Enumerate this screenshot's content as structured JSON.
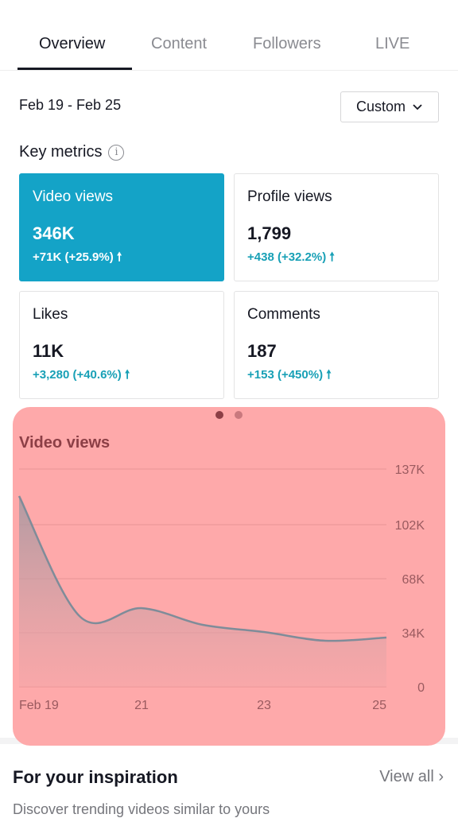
{
  "tabs": [
    {
      "label": "Overview",
      "active": true
    },
    {
      "label": "Content"
    },
    {
      "label": "Followers"
    },
    {
      "label": "LIVE"
    }
  ],
  "date_range": "Feb 19 - Feb 25",
  "range_select": "Custom",
  "key_metrics": {
    "title": "Key metrics",
    "cards": [
      {
        "label": "Video views",
        "value": "346K",
        "change": "+71K (+25.9%)",
        "selected": true
      },
      {
        "label": "Profile views",
        "value": "1,799",
        "change": "+438 (+32.2%)"
      },
      {
        "label": "Likes",
        "value": "11K",
        "change": "+3,280 (+40.6%)"
      },
      {
        "label": "Comments",
        "value": "187",
        "change": "+153 (+450%)"
      }
    ]
  },
  "colors": {
    "accent": "#14a3c7",
    "change": "#18a0b6",
    "chart_bg": "#fea9aa",
    "line": "#7f8c99"
  },
  "chart_data": {
    "type": "area",
    "title": "Video views",
    "x": [
      "Feb 19",
      "Feb 20",
      "Feb 21",
      "Feb 22",
      "Feb 23",
      "Feb 24",
      "Feb 25"
    ],
    "x_tick_labels": [
      "Feb 19",
      "21",
      "23",
      "25"
    ],
    "values": [
      120000,
      44000,
      49500,
      39000,
      34500,
      29000,
      31000
    ],
    "y_ticks": [
      "137K",
      "102K",
      "68K",
      "34K",
      "0"
    ],
    "y_tick_values": [
      137000,
      102000,
      68000,
      34000,
      0
    ],
    "ylim": [
      0,
      137000
    ],
    "grid": true
  },
  "inspiration": {
    "title": "For your inspiration",
    "view_all": "View all",
    "description": "Discover trending videos similar to yours"
  }
}
